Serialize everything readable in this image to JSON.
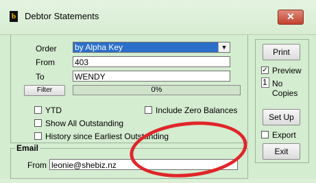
{
  "window": {
    "title": "Debtor Statements",
    "close_symbol": "✕"
  },
  "options": {
    "order_label": "Order",
    "order_value": "by Alpha Key",
    "from_label": "From",
    "from_value": "403",
    "to_label": "To",
    "to_value": "WENDY",
    "filter_label": "Filter",
    "progress_percent": 0,
    "progress_text": "0%"
  },
  "checkboxes": {
    "ytd": {
      "label": "YTD",
      "checked": false
    },
    "include_zero": {
      "label": "Include Zero Balances",
      "checked": false
    },
    "show_all": {
      "label": "Show All Outstanding",
      "checked": false
    },
    "history": {
      "label": "History since Earliest Outstanding",
      "checked": false
    }
  },
  "email": {
    "group_title": "Email",
    "from_label": "From",
    "from_value": "leonie@shebiz.nz"
  },
  "side": {
    "print_label": "Print",
    "preview_label": "Preview",
    "preview_checked": true,
    "copies_value": "1",
    "copies_label": "No Copies",
    "setup_label": "Set Up",
    "export_label": "Export",
    "export_checked": false,
    "exit_label": "Exit"
  },
  "annotation": {
    "color": "#e0262a"
  },
  "colors": {
    "select_bg": "#2b6fc9",
    "close_bg": "#c24330",
    "window_bg": "#d4ecd0"
  }
}
